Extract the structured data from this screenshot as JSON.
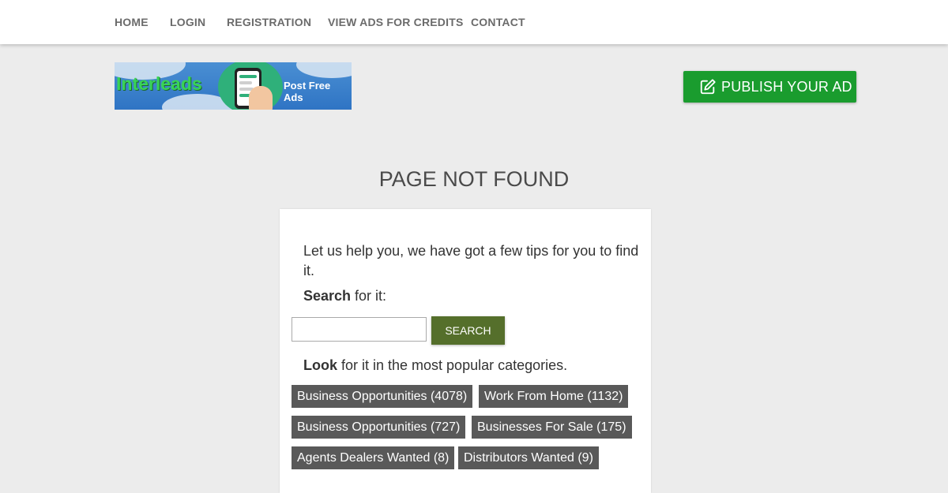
{
  "nav": {
    "items": [
      {
        "label": "HOME"
      },
      {
        "label": "LOGIN"
      },
      {
        "label": "REGISTRATION"
      },
      {
        "label": "VIEW ADS FOR CREDITS"
      },
      {
        "label": "CONTACT"
      }
    ]
  },
  "logo": {
    "brand": "Interleads",
    "tagline": "Post Free Ads"
  },
  "header": {
    "publish_label": "PUBLISH YOUR AD",
    "publish_icon": "edit-icon"
  },
  "main": {
    "title": "PAGE NOT FOUND",
    "tips": "Let us help you, we have got a few tips for you to find it.",
    "search_strong": "Search",
    "search_rest": " for it:",
    "search_button": "SEARCH",
    "search_value": "",
    "look_strong": "Look",
    "look_rest": " for it in the most popular categories.",
    "categories": [
      {
        "label": "Business Opportunities (4078)"
      },
      {
        "label": "Work From Home (1132)"
      },
      {
        "label": "Business Opportunities (727)"
      },
      {
        "label": "Businesses For Sale (175)"
      },
      {
        "label": "Agents Dealers Wanted (8)"
      },
      {
        "label": "Distributors Wanted (9)"
      }
    ]
  },
  "colors": {
    "publish": "#1a9c2e",
    "search_button": "#556f2b",
    "category_chip": "#595959",
    "background": "#ececec"
  }
}
